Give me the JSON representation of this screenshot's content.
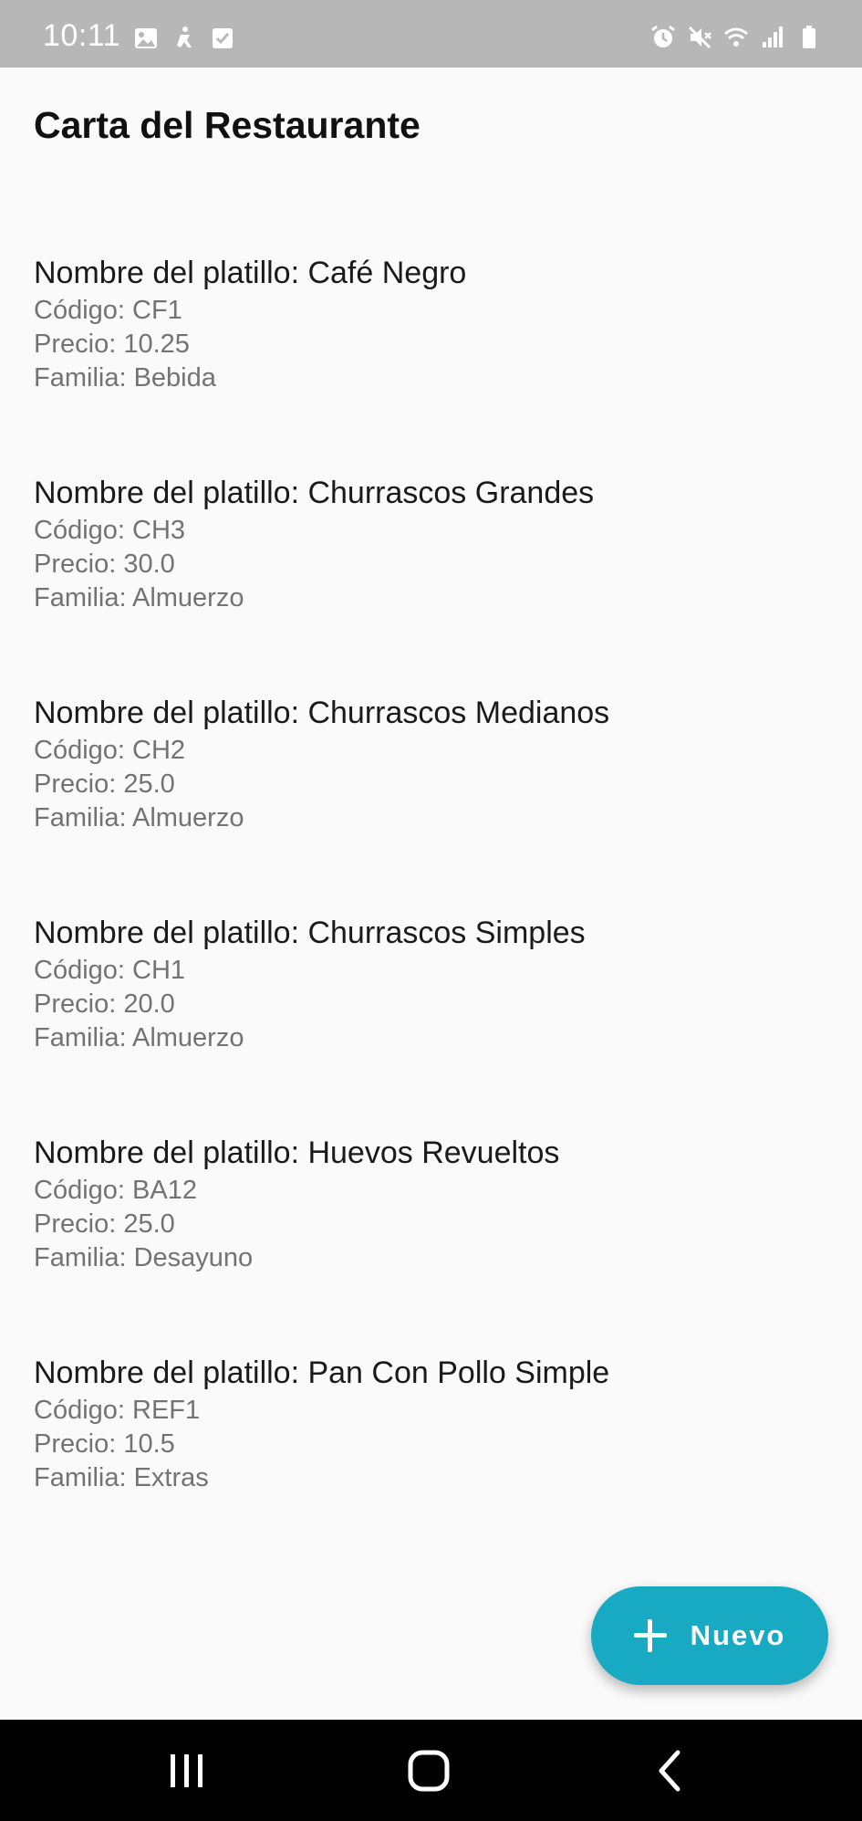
{
  "status_bar": {
    "time": "10:11",
    "left_icons": [
      "gallery-icon",
      "accessibility-icon",
      "checkbox-icon"
    ],
    "right_icons": [
      "alarm-icon",
      "mute-icon",
      "wifi-icon",
      "signal-icon",
      "battery-icon"
    ]
  },
  "app": {
    "title": "Carta del Restaurante"
  },
  "dishes": [
    {
      "name": "Nombre del platillo: Café Negro",
      "code": "Código: CF1",
      "price": "Precio: 10.25",
      "family": "Familia: Bebida"
    },
    {
      "name": "Nombre del platillo: Churrascos Grandes",
      "code": "Código: CH3",
      "price": "Precio: 30.0",
      "family": "Familia: Almuerzo"
    },
    {
      "name": "Nombre del platillo: Churrascos Medianos",
      "code": "Código: CH2",
      "price": "Precio: 25.0",
      "family": "Familia: Almuerzo"
    },
    {
      "name": "Nombre del platillo: Churrascos Simples",
      "code": "Código: CH1",
      "price": "Precio: 20.0",
      "family": "Familia: Almuerzo"
    },
    {
      "name": "Nombre del platillo: Huevos Revueltos",
      "code": "Código: BA12",
      "price": "Precio: 25.0",
      "family": "Familia: Desayuno"
    },
    {
      "name": "Nombre del platillo: Pan Con Pollo Simple",
      "code": "Código: REF1",
      "price": "Precio: 10.5",
      "family": "Familia: Extras"
    }
  ],
  "fab": {
    "label": "Nuevo",
    "icon": "plus-icon",
    "color": "#18a9c3"
  },
  "nav_bar": {
    "buttons": [
      "recent-apps-icon",
      "home-icon",
      "back-icon"
    ]
  }
}
